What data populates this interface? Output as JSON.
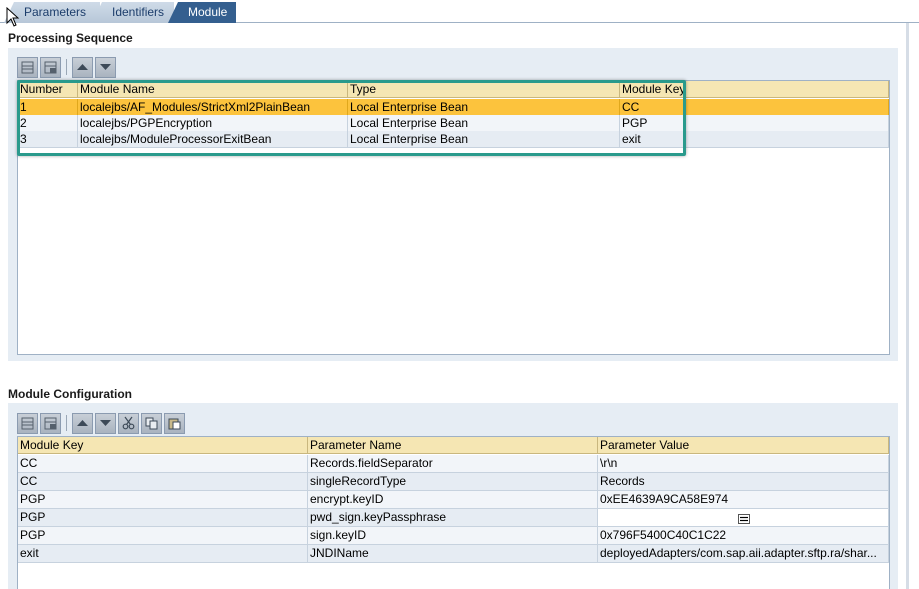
{
  "tabs": [
    {
      "label": "Parameters"
    },
    {
      "label": "Identifiers"
    },
    {
      "label": "Module"
    }
  ],
  "processing": {
    "title": "Processing Sequence",
    "columns": [
      "Number",
      "Module Name",
      "Type",
      "Module Key"
    ],
    "rows": [
      {
        "number": "1",
        "name": "localejbs/AF_Modules/StrictXml2PlainBean",
        "type": "Local Enterprise Bean",
        "key": "CC"
      },
      {
        "number": "2",
        "name": "localejbs/PGPEncryption",
        "type": "Local Enterprise Bean",
        "key": "PGP"
      },
      {
        "number": "3",
        "name": "localejbs/ModuleProcessorExitBean",
        "type": "Local Enterprise Bean",
        "key": "exit"
      }
    ]
  },
  "config": {
    "title": "Module Configuration",
    "columns": [
      "Module Key",
      "Parameter Name",
      "Parameter Value"
    ],
    "rows": [
      {
        "key": "CC",
        "param": "Records.fieldSeparator",
        "value": "\\r\\n"
      },
      {
        "key": "CC",
        "param": "singleRecordType",
        "value": "Records"
      },
      {
        "key": "PGP",
        "param": "encrypt.keyID",
        "value": "0xEE4639A9CA58E974"
      },
      {
        "key": "PGP",
        "param": "pwd_sign.keyPassphrase",
        "value": ""
      },
      {
        "key": "PGP",
        "param": "sign.keyID",
        "value": "0x796F5400C40C1C22"
      },
      {
        "key": "exit",
        "param": "JNDIName",
        "value": "deployedAdapters/com.sap.aii.adapter.sftp.ra/shar..."
      }
    ]
  },
  "icons": {
    "insert": "insert-row-icon",
    "delete": "delete-row-icon",
    "up": "move-up-icon",
    "down": "move-down-icon",
    "cut": "cut-icon",
    "copy": "copy-icon",
    "paste": "paste-icon"
  },
  "colors": {
    "selected_row": "#fcc33d",
    "header": "#f5e6b3",
    "highlight_box": "#2a9a8c",
    "active_tab": "#345f8f"
  }
}
